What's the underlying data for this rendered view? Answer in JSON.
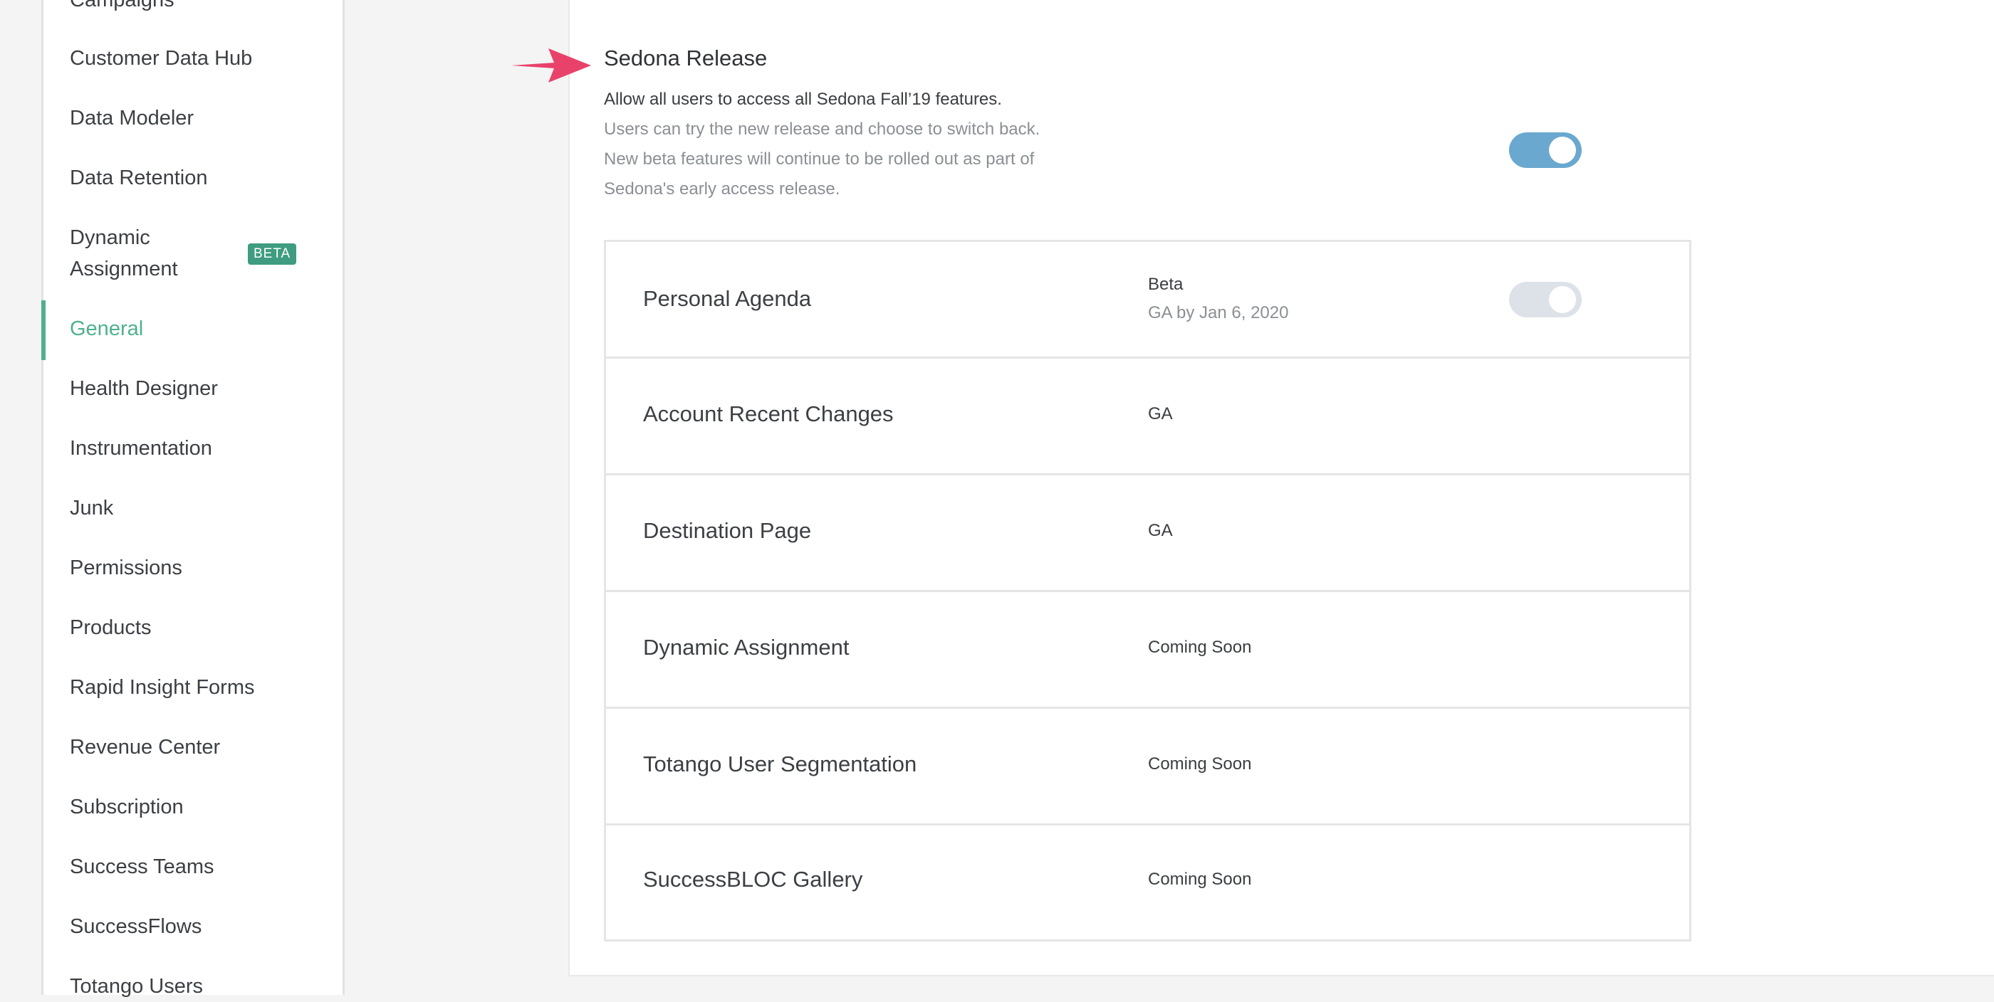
{
  "sidebar": {
    "items": [
      {
        "label": "Campaigns"
      },
      {
        "label": "Customer Data Hub"
      },
      {
        "label": "Data Modeler"
      },
      {
        "label": "Data Retention"
      },
      {
        "label": "Dynamic",
        "label_line2": "Assignment",
        "badge": "BETA"
      },
      {
        "label": "General",
        "active": true
      },
      {
        "label": "Health Designer"
      },
      {
        "label": "Instrumentation"
      },
      {
        "label": "Junk"
      },
      {
        "label": "Permissions"
      },
      {
        "label": "Products"
      },
      {
        "label": "Rapid Insight Forms"
      },
      {
        "label": "Revenue Center"
      },
      {
        "label": "Subscription"
      },
      {
        "label": "Success Teams"
      },
      {
        "label": "SuccessFlows"
      },
      {
        "label": "Totango Users"
      }
    ]
  },
  "release": {
    "title": "Sedona Release",
    "description": "Allow all users to access all Sedona Fall’19 features.",
    "sub_lines": [
      "Users can try the new release and choose to switch back.",
      "New beta features will continue to be rolled out as part of",
      "Sedona's early access release."
    ],
    "toggle_on": true
  },
  "features": [
    {
      "name": "Personal Agenda",
      "status": "Beta",
      "ga_date": "GA by Jan 6, 2020",
      "toggle_state": "disabled"
    },
    {
      "name": "Account Recent Changes",
      "status": "GA"
    },
    {
      "name": "Destination Page",
      "status": "GA"
    },
    {
      "name": "Dynamic Assignment",
      "status": "Coming Soon"
    },
    {
      "name": "Totango User Segmentation",
      "status": "Coming Soon"
    },
    {
      "name": "SuccessBLOC Gallery",
      "status": "Coming Soon"
    }
  ],
  "colors": {
    "accent_green": "#4fb08e",
    "toggle_blue": "#6aa8cf",
    "arrow_pink": "#e8426b",
    "badge_green": "#3f9c80"
  },
  "icons": {
    "annotation_arrow": "arrow-right-icon"
  }
}
